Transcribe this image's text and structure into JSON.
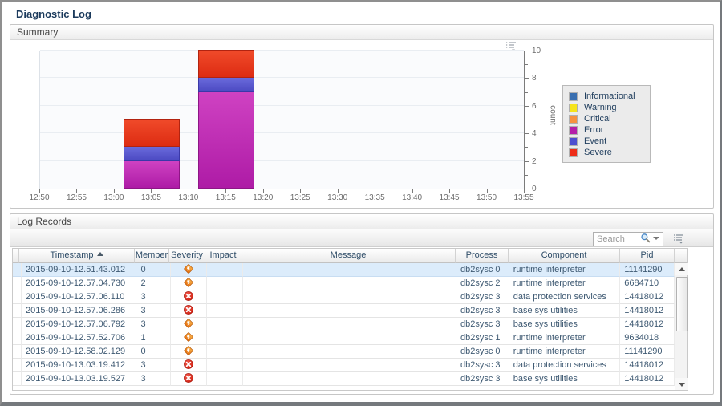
{
  "window": {
    "title": "Diagnostic Log"
  },
  "summary_panel": {
    "title": "Summary"
  },
  "chart_data": {
    "type": "bar",
    "stacked": true,
    "title": "",
    "xlabel": "",
    "ylabel": "count",
    "ylim": [
      0,
      10
    ],
    "y_major_ticks": [
      0,
      2,
      4,
      6,
      8,
      10
    ],
    "x_ticks": [
      "12:50",
      "12:55",
      "13:00",
      "13:05",
      "13:10",
      "13:15",
      "13:20",
      "13:25",
      "13:30",
      "13:35",
      "13:40",
      "13:45",
      "13:50",
      "13:55"
    ],
    "legend_position": "right",
    "legend": [
      {
        "label": "Informational",
        "color": "#3a6fb0"
      },
      {
        "label": "Warning",
        "color": "#f6e41b"
      },
      {
        "label": "Critical",
        "color": "#f79240"
      },
      {
        "label": "Error",
        "color": "#b51fa8"
      },
      {
        "label": "Event",
        "color": "#4d4ecf"
      },
      {
        "label": "Severe",
        "color": "#ee2d18"
      }
    ],
    "series_colors": {
      "Error": {
        "top": "#cf42c2",
        "bottom": "#ae1ba6",
        "border": "#8e1586"
      },
      "Event": {
        "top": "#6a6adc",
        "bottom": "#4c4ac2",
        "border": "#3a38a8"
      },
      "Severe": {
        "top": "#f04a2a",
        "bottom": "#dd2c12",
        "border": "#b22310"
      }
    },
    "bars": [
      {
        "center_tick": "13:05",
        "segments": [
          {
            "name": "Error",
            "value": 2
          },
          {
            "name": "Event",
            "value": 1
          },
          {
            "name": "Severe",
            "value": 2
          }
        ]
      },
      {
        "center_tick": "13:15",
        "segments": [
          {
            "name": "Error",
            "value": 7
          },
          {
            "name": "Event",
            "value": 1
          },
          {
            "name": "Severe",
            "value": 2
          }
        ]
      }
    ]
  },
  "log_panel": {
    "title": "Log Records",
    "search_placeholder": "Search",
    "sorted_by": "Timestamp",
    "sort_direction": "asc",
    "columns": [
      "",
      "Timestamp",
      "Member",
      "Severity",
      "Impact",
      "Message",
      "Process",
      "Component",
      "Pid"
    ],
    "rows": [
      {
        "timestamp": "2015-09-10-12.51.43.012",
        "member": "0",
        "severity": "warning",
        "impact": "",
        "message": "",
        "process": "db2sysc 0",
        "component": "runtime interpreter",
        "pid": "11141290",
        "selected": true
      },
      {
        "timestamp": "2015-09-10-12.57.04.730",
        "member": "2",
        "severity": "warning",
        "impact": "",
        "message": "",
        "process": "db2sysc 2",
        "component": "runtime interpreter",
        "pid": "6684710",
        "selected": false
      },
      {
        "timestamp": "2015-09-10-12.57.06.110",
        "member": "3",
        "severity": "error",
        "impact": "",
        "message": "",
        "process": "db2sysc 3",
        "component": "data protection services",
        "pid": "14418012",
        "selected": false
      },
      {
        "timestamp": "2015-09-10-12.57.06.286",
        "member": "3",
        "severity": "error",
        "impact": "",
        "message": "",
        "process": "db2sysc 3",
        "component": "base sys utilities",
        "pid": "14418012",
        "selected": false
      },
      {
        "timestamp": "2015-09-10-12.57.06.792",
        "member": "3",
        "severity": "warning",
        "impact": "",
        "message": "",
        "process": "db2sysc 3",
        "component": "base sys utilities",
        "pid": "14418012",
        "selected": false
      },
      {
        "timestamp": "2015-09-10-12.57.52.706",
        "member": "1",
        "severity": "warning",
        "impact": "",
        "message": "",
        "process": "db2sysc 1",
        "component": "runtime interpreter",
        "pid": "9634018",
        "selected": false
      },
      {
        "timestamp": "2015-09-10-12.58.02.129",
        "member": "0",
        "severity": "warning",
        "impact": "",
        "message": "",
        "process": "db2sysc 0",
        "component": "runtime interpreter",
        "pid": "11141290",
        "selected": false
      },
      {
        "timestamp": "2015-09-10-13.03.19.412",
        "member": "3",
        "severity": "error",
        "impact": "",
        "message": "",
        "process": "db2sysc 3",
        "component": "data protection services",
        "pid": "14418012",
        "selected": false
      },
      {
        "timestamp": "2015-09-10-13.03.19.527",
        "member": "3",
        "severity": "error",
        "impact": "",
        "message": "",
        "process": "db2sysc 3",
        "component": "base sys utilities",
        "pid": "14418012",
        "selected": false
      }
    ]
  }
}
